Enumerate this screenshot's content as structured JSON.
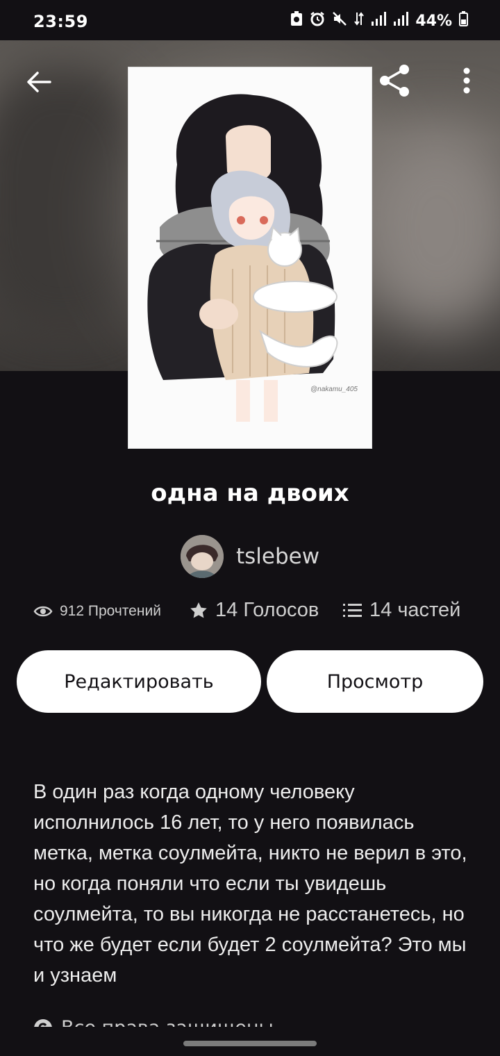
{
  "status_bar": {
    "time": "23:59",
    "battery": "44%"
  },
  "header": {
    "back_icon": "arrow-left-icon",
    "share_icon": "share-icon",
    "more_icon": "more-vertical-icon"
  },
  "story": {
    "title": "одна на двоих",
    "author": "tslebew",
    "cover_watermark": "@nakamu_405"
  },
  "stats": {
    "reads": "912 Прочтений",
    "votes": "14 Голосов",
    "parts": "14 частей"
  },
  "actions": {
    "edit_label": "Редактировать",
    "view_label": "Просмотр"
  },
  "description": "В один раз когда одному человеку исполнилось 16 лет, то у него появилась метка, метка соулмейта, никто не верил в это, но когда поняли что если ты увидешь соулмейта, то вы никогда не расстанетесь, но что же будет если будет 2 соулмейта? Это мы и узнаем",
  "copyright": "Все права защищены",
  "colors": {
    "background": "#121014",
    "button": "#ffffff",
    "text": "#ffffff"
  }
}
